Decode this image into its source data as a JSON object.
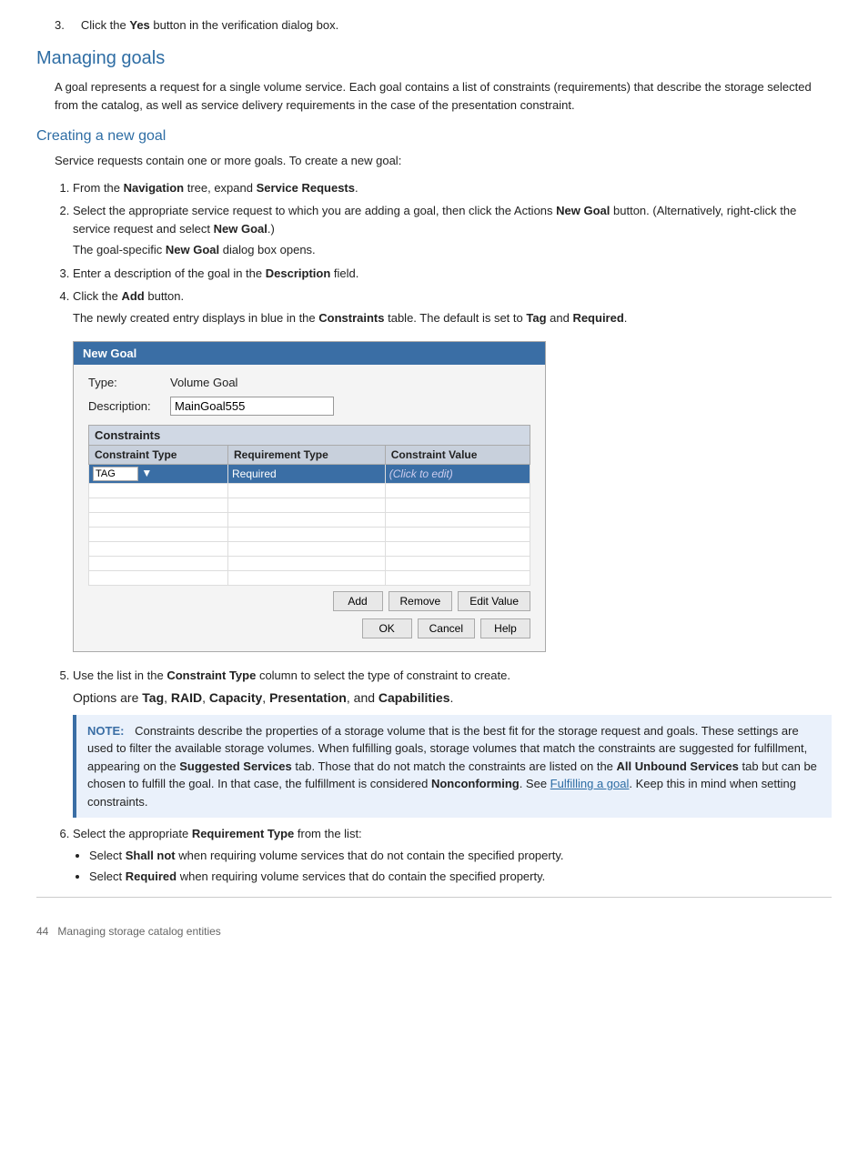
{
  "step3_intro": {
    "number": "3.",
    "text": "Click the ",
    "bold": "Yes",
    "rest": " button in the verification dialog box."
  },
  "managing_goals": {
    "heading": "Managing goals",
    "description": "A goal represents a request for a single volume service. Each goal contains a list of constraints (requirements) that describe the storage selected from the catalog, as well as service delivery requirements in the case of the presentation constraint."
  },
  "creating_new_goal": {
    "heading": "Creating a new goal",
    "intro": "Service requests contain one or more goals. To create a new goal:",
    "steps": [
      {
        "num": 1,
        "text_before": "From the ",
        "bold1": "Navigation",
        "text_mid": " tree, expand ",
        "bold2": "Service Requests",
        "text_after": "."
      },
      {
        "num": 2,
        "text_before": "Select the appropriate service request to which you are adding a goal, then click the Actions ",
        "bold1": "New Goal",
        "text_mid": " button. (Alternatively, right-click the service request and select ",
        "bold2": "New Goal",
        "text_after": ".)"
      },
      {
        "num": 2,
        "subnote": "The goal-specific ",
        "subnote_bold": "New Goal",
        "subnote_rest": " dialog box opens."
      },
      {
        "num": 3,
        "text_before": "Enter a description of the goal in the ",
        "bold1": "Description",
        "text_after": " field."
      },
      {
        "num": 4,
        "text_before": "Click the ",
        "bold1": "Add",
        "text_after": " button."
      },
      {
        "num": 4,
        "subnote": "The newly created entry displays in blue in the ",
        "subnote_bold": "Constraints",
        "subnote_rest": " table. The default is set to ",
        "subnote_bold2": "Tag",
        "subnote_rest2": " and ",
        "subnote_bold3": "Required",
        "subnote_rest3": "."
      }
    ]
  },
  "dialog": {
    "title": "New Goal",
    "type_label": "Type:",
    "type_value": "Volume Goal",
    "desc_label": "Description:",
    "desc_value": "MainGoal555",
    "constraints_label": "Constraints",
    "table_headers": [
      "Constraint Type",
      "Requirement Type",
      "Constraint Value"
    ],
    "selected_row": {
      "type": "TAG",
      "req_type": "Required",
      "value": "(Click to edit)"
    },
    "empty_rows": 7,
    "buttons_row1": [
      "Add",
      "Remove",
      "Edit Value"
    ],
    "buttons_row2": [
      "OK",
      "Cancel",
      "Help"
    ]
  },
  "step5": {
    "number": "5.",
    "text_before": "Use the list in the ",
    "bold": "Constraint Type",
    "text_after": " column to select the type of constraint to create.",
    "options_line": "Options are ",
    "options": [
      "Tag",
      "RAID",
      "Capacity",
      "Presentation",
      "and",
      "Capabilities"
    ]
  },
  "note": {
    "label": "NOTE:",
    "text1": "Constraints describe the properties of a storage volume that is the best fit for the storage request and goals. These settings are used to filter the available storage volumes. When fulfilling goals, storage volumes that match the constraints are suggested for fulfillment, appearing on the ",
    "bold1": "Suggested Services",
    "text2": " tab. Those that do not match the constraints are listed on the ",
    "bold2": "All Unbound Services",
    "text3": " tab but can be chosen to fulfill the goal. In that case, the fulfillment is considered ",
    "bold3": "Nonconforming",
    "text4": ". See ",
    "link": "Fulfilling a goal",
    "text5": ". Keep this in mind when setting constraints."
  },
  "step6": {
    "number": "6.",
    "text_before": "Select the appropriate ",
    "bold": "Requirement Type",
    "text_after": " from the list:",
    "bullets": [
      {
        "text_before": "Select ",
        "bold": "Shall not",
        "text_after": " when requiring volume services that do not contain the specified property."
      },
      {
        "text_before": "Select ",
        "bold": "Required",
        "text_after": " when requiring volume services that do contain the specified property."
      }
    ]
  },
  "footer": {
    "page_num": "44",
    "text": "Managing storage catalog entities"
  }
}
